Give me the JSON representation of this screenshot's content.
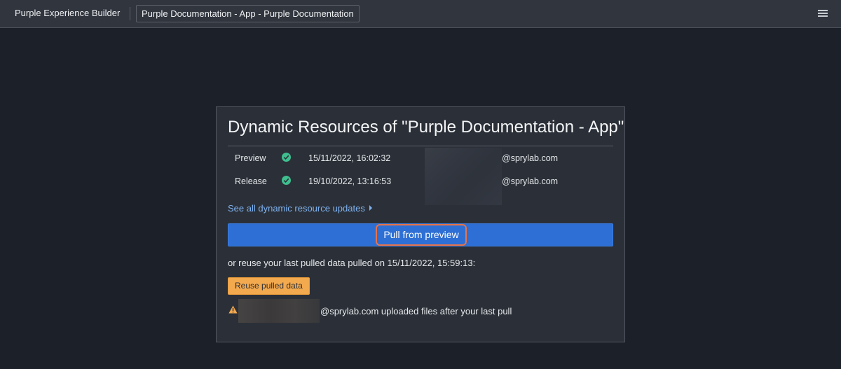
{
  "topbar": {
    "app_name": "Purple Experience Builder",
    "document_title": "Purple Documentation - App - Purple Documentation",
    "menu_icon": "hamburger-icon"
  },
  "card": {
    "title": "Dynamic Resources of \"Purple Documentation - App\"",
    "rows": [
      {
        "environment": "Preview",
        "status_icon": "check-circle-icon",
        "timestamp": "15/11/2022, 16:02:32",
        "user_email": "@sprylab.com"
      },
      {
        "environment": "Release",
        "status_icon": "check-circle-icon",
        "timestamp": "19/10/2022, 13:16:53",
        "user_email": "@sprylab.com"
      }
    ],
    "see_all_link": "See all dynamic resource updates",
    "pull_button": "Pull from preview",
    "reuse_text": "or reuse your last pulled data pulled on 15/11/2022, 15:59:13:",
    "reuse_button": "Reuse pulled data",
    "warning": {
      "icon": "warning-icon",
      "text": "@sprylab.com uploaded files after your last pull"
    }
  },
  "colors": {
    "background": "#1c2028",
    "topbar": "#30353e",
    "card": "#2b3038",
    "primary": "#2d6fd4",
    "link": "#7fb2f0",
    "success": "#3fbf8f",
    "warning": "#f3a94e",
    "highlight_outline": "#e8734a"
  }
}
